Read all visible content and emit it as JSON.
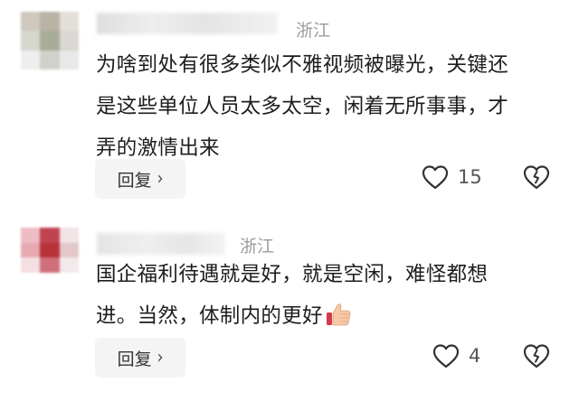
{
  "comments": [
    {
      "location": "浙江",
      "lines": [
        "为啥到处有很多类似不雅视频被曝光，关键还",
        "是这些单位人员太多太空，闲着无所事事，才",
        "弄的激情出来"
      ],
      "reply_label": "回复",
      "reply_chevron": "›",
      "likes": "15",
      "avatar_colors": [
        "#cfc9bd",
        "#b9b3a6",
        "#e3dfd7",
        "#d7d7d0",
        "#a7ad98",
        "#dad7d2",
        "#eeeeee",
        "#d2d0cb",
        "#e8e8e8"
      ]
    },
    {
      "location": "浙江",
      "lines": [
        "国企福利待遇就是好，就是空闲，难怪都想",
        "进。当然，体制内的更好"
      ],
      "emoji": "thumbs-up",
      "reply_label": "回复",
      "reply_chevron": "›",
      "likes": "4",
      "avatar_colors": [
        "#eebcc4",
        "#c0444f",
        "#f2e4e6",
        "#e8a9b1",
        "#b8323a",
        "#e3c7c9",
        "#f4dfe2",
        "#cf6f7a",
        "#f1e9ea"
      ]
    }
  ],
  "icons": {
    "like": "heart-outline-icon",
    "dislike": "broken-heart-outline-icon",
    "emoji": "thumbs-up-emoji"
  }
}
